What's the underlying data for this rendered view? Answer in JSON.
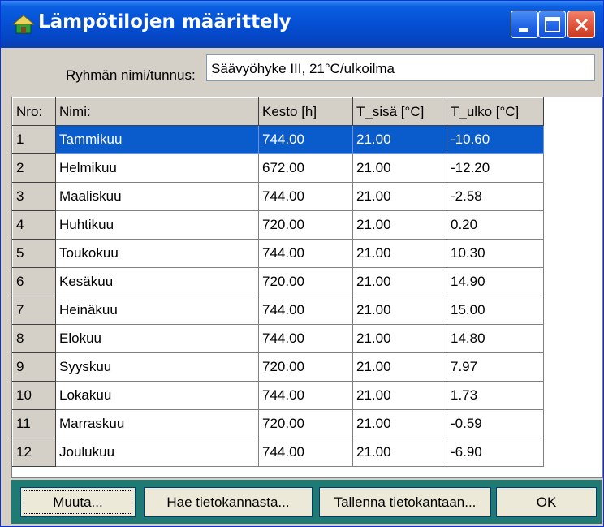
{
  "window": {
    "title": "Lämpötilojen määrittely"
  },
  "group": {
    "label": "Ryhmän nimi/tunnus:",
    "value": "Säävyöhyke III, 21°C/ulkoilma"
  },
  "table": {
    "columns": [
      "Nro:",
      "Nimi:",
      "Kesto [h]",
      "T_sisä [°C]",
      "T_ulko [°C]"
    ],
    "rows": [
      [
        "1",
        "Tammikuu",
        "744.00",
        "21.00",
        "-10.60"
      ],
      [
        "2",
        "Helmikuu",
        "672.00",
        "21.00",
        "-12.20"
      ],
      [
        "3",
        "Maaliskuu",
        "744.00",
        "21.00",
        "-2.58"
      ],
      [
        "4",
        "Huhtikuu",
        "720.00",
        "21.00",
        "0.20"
      ],
      [
        "5",
        "Toukokuu",
        "744.00",
        "21.00",
        "10.30"
      ],
      [
        "6",
        "Kesäkuu",
        "720.00",
        "21.00",
        "14.90"
      ],
      [
        "7",
        "Heinäkuu",
        "744.00",
        "21.00",
        "15.00"
      ],
      [
        "8",
        "Elokuu",
        "744.00",
        "21.00",
        "14.80"
      ],
      [
        "9",
        "Syyskuu",
        "720.00",
        "21.00",
        "7.97"
      ],
      [
        "10",
        "Lokakuu",
        "744.00",
        "21.00",
        "1.73"
      ],
      [
        "11",
        "Marraskuu",
        "720.00",
        "21.00",
        "-0.59"
      ],
      [
        "12",
        "Joulukuu",
        "744.00",
        "21.00",
        "-6.90"
      ]
    ],
    "selected_row": 0
  },
  "buttons": {
    "muuta": "Muuta...",
    "hae": "Hae tietokannasta...",
    "tallenna": "Tallenna tietokantaan...",
    "ok": "OK"
  },
  "colors": {
    "titlebar": "#0651d5",
    "selection": "#0a5ccc",
    "button_bar": "#1f7a73",
    "face": "#d4d0c8"
  },
  "icons": {
    "app": "house-icon",
    "minimize": "minimize-icon",
    "maximize": "maximize-icon",
    "close": "close-icon"
  }
}
